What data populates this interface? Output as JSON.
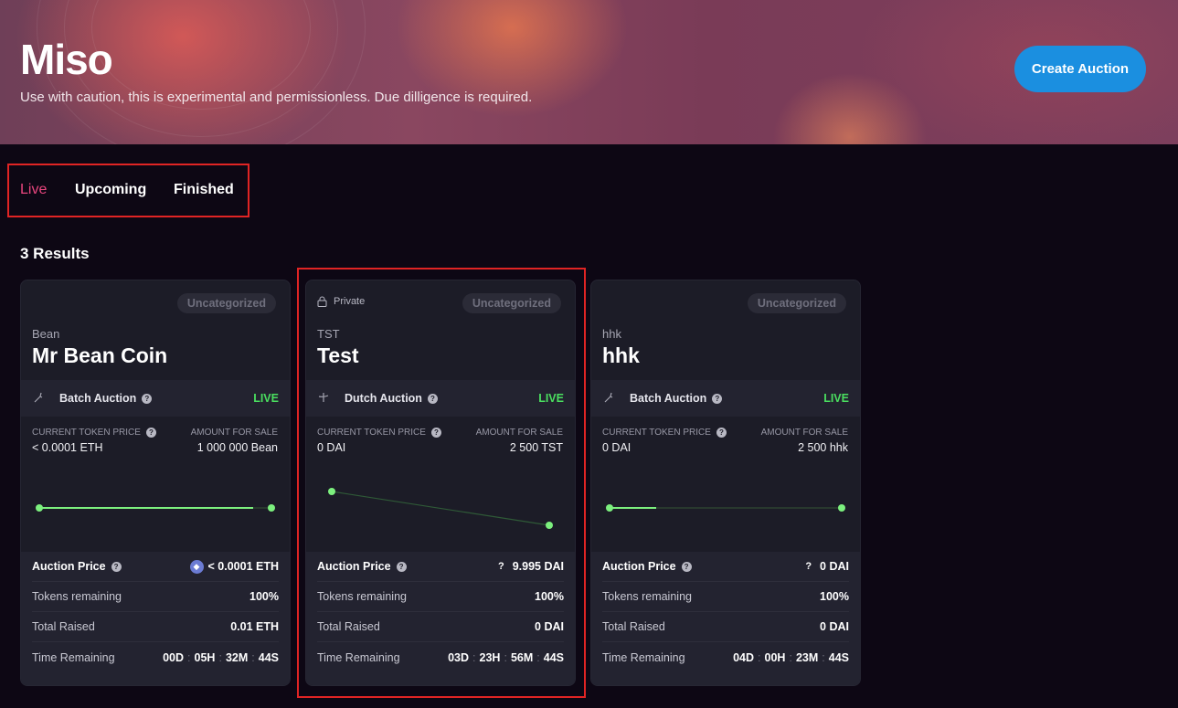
{
  "header": {
    "title": "Miso",
    "subtitle": "Use with caution, this is experimental and permissionless. Due dilligence is required.",
    "create_button": "Create Auction"
  },
  "tabs": [
    {
      "label": "Live",
      "active": true
    },
    {
      "label": "Upcoming",
      "active": false
    },
    {
      "label": "Finished",
      "active": false
    }
  ],
  "results_label": "3 Results",
  "labels": {
    "current_token_price": "CURRENT TOKEN PRICE",
    "amount_for_sale": "AMOUNT FOR SALE",
    "auction_price": "Auction Price",
    "tokens_remaining": "Tokens remaining",
    "total_raised": "Total Raised",
    "time_remaining": "Time Remaining",
    "private": "Private"
  },
  "cards": [
    {
      "category": "Uncategorized",
      "symbol": "Bean",
      "name": "Mr Bean Coin",
      "auction_type": "Batch Auction",
      "status": "LIVE",
      "current_token_price": "< 0.0001 ETH",
      "amount_for_sale": "1 000 000 Bean",
      "auction_price": "< 0.0001 ETH",
      "tokens_remaining": "100%",
      "total_raised": "0.01 ETH",
      "time": {
        "d": "00D",
        "h": "05H",
        "m": "32M",
        "s": "44S"
      }
    },
    {
      "category": "Uncategorized",
      "symbol": "TST",
      "name": "Test",
      "auction_type": "Dutch Auction",
      "status": "LIVE",
      "current_token_price": "0 DAI",
      "amount_for_sale": "2 500 TST",
      "auction_price": "9.995 DAI",
      "auction_price_prefix": "?",
      "tokens_remaining": "100%",
      "total_raised": "0 DAI",
      "time": {
        "d": "03D",
        "h": "23H",
        "m": "56M",
        "s": "44S"
      }
    },
    {
      "category": "Uncategorized",
      "symbol": "hhk",
      "name": "hhk",
      "auction_type": "Batch Auction",
      "status": "LIVE",
      "current_token_price": "0 DAI",
      "amount_for_sale": "2 500 hhk",
      "auction_price": "0 DAI",
      "auction_price_prefix": "?",
      "tokens_remaining": "100%",
      "total_raised": "0 DAI",
      "time": {
        "d": "04D",
        "h": "00H",
        "m": "23M",
        "s": "44S"
      }
    }
  ],
  "progress": [
    0.94,
    0.0,
    0.2
  ],
  "colors": {
    "accent": "#1b8fe0",
    "live": "#4ade5f",
    "active_tab": "#e8467e",
    "highlight": "#e02424"
  }
}
